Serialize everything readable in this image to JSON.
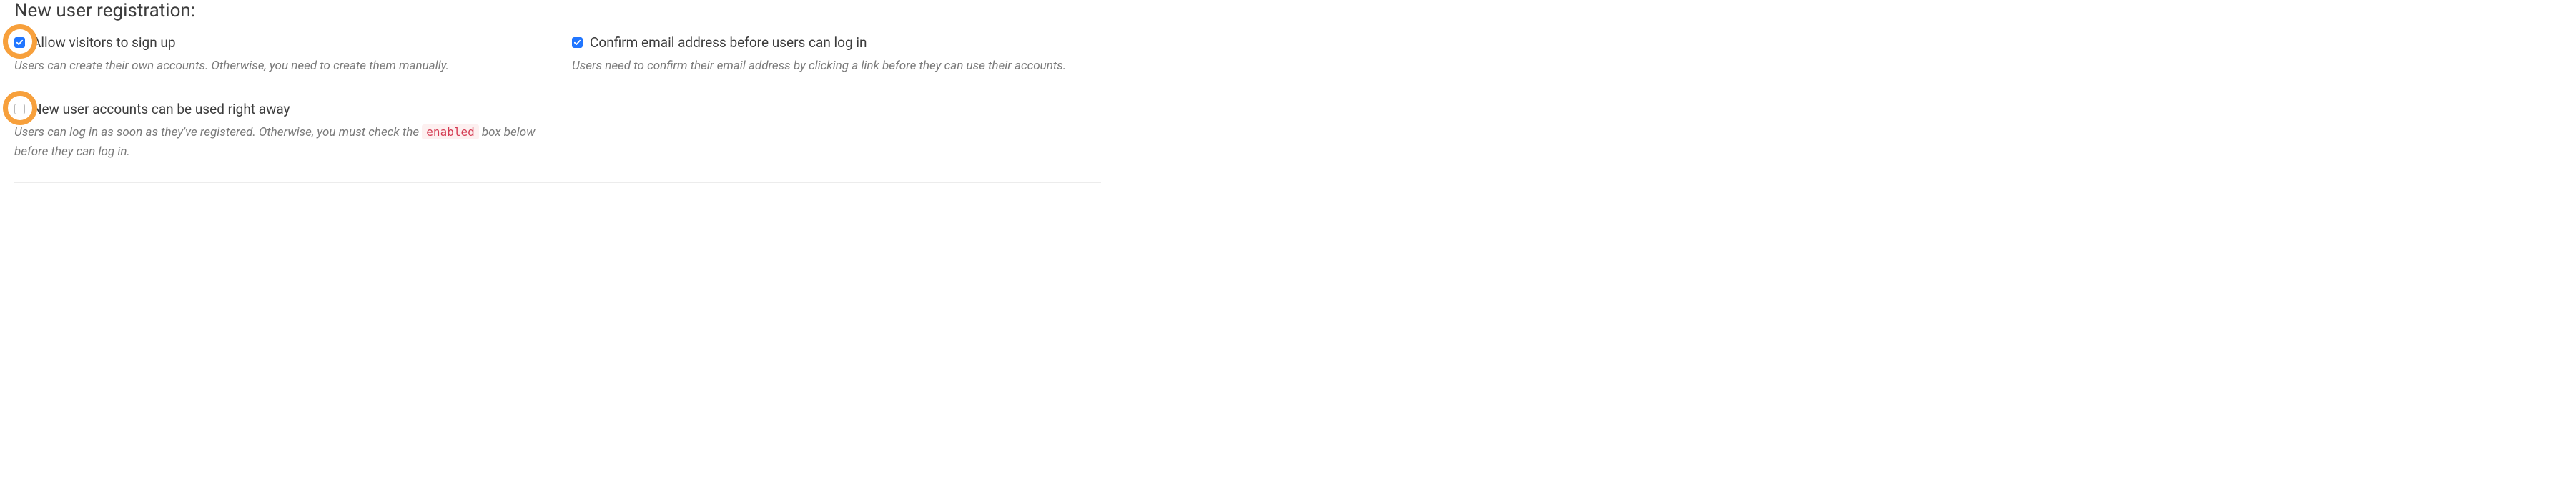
{
  "heading": "New user registration:",
  "options": {
    "allow_signup": {
      "label": "Allow visitors to sign up",
      "description_before": "Users can create their own accounts. Otherwise, you need to create them manually.",
      "checked": true,
      "highlighted": true
    },
    "confirm_email": {
      "label": "Confirm email address before users can log in",
      "description_before": "Users need to confirm their email address by clicking a link before they can use their accounts.",
      "checked": true,
      "highlighted": false
    },
    "use_right_away": {
      "label": "New user accounts can be used right away",
      "description_before": "Users can log in as soon as they've registered. Otherwise, you must check the ",
      "description_code": "enabled",
      "description_after": " box below before they can log in.",
      "checked": false,
      "highlighted": true
    }
  }
}
